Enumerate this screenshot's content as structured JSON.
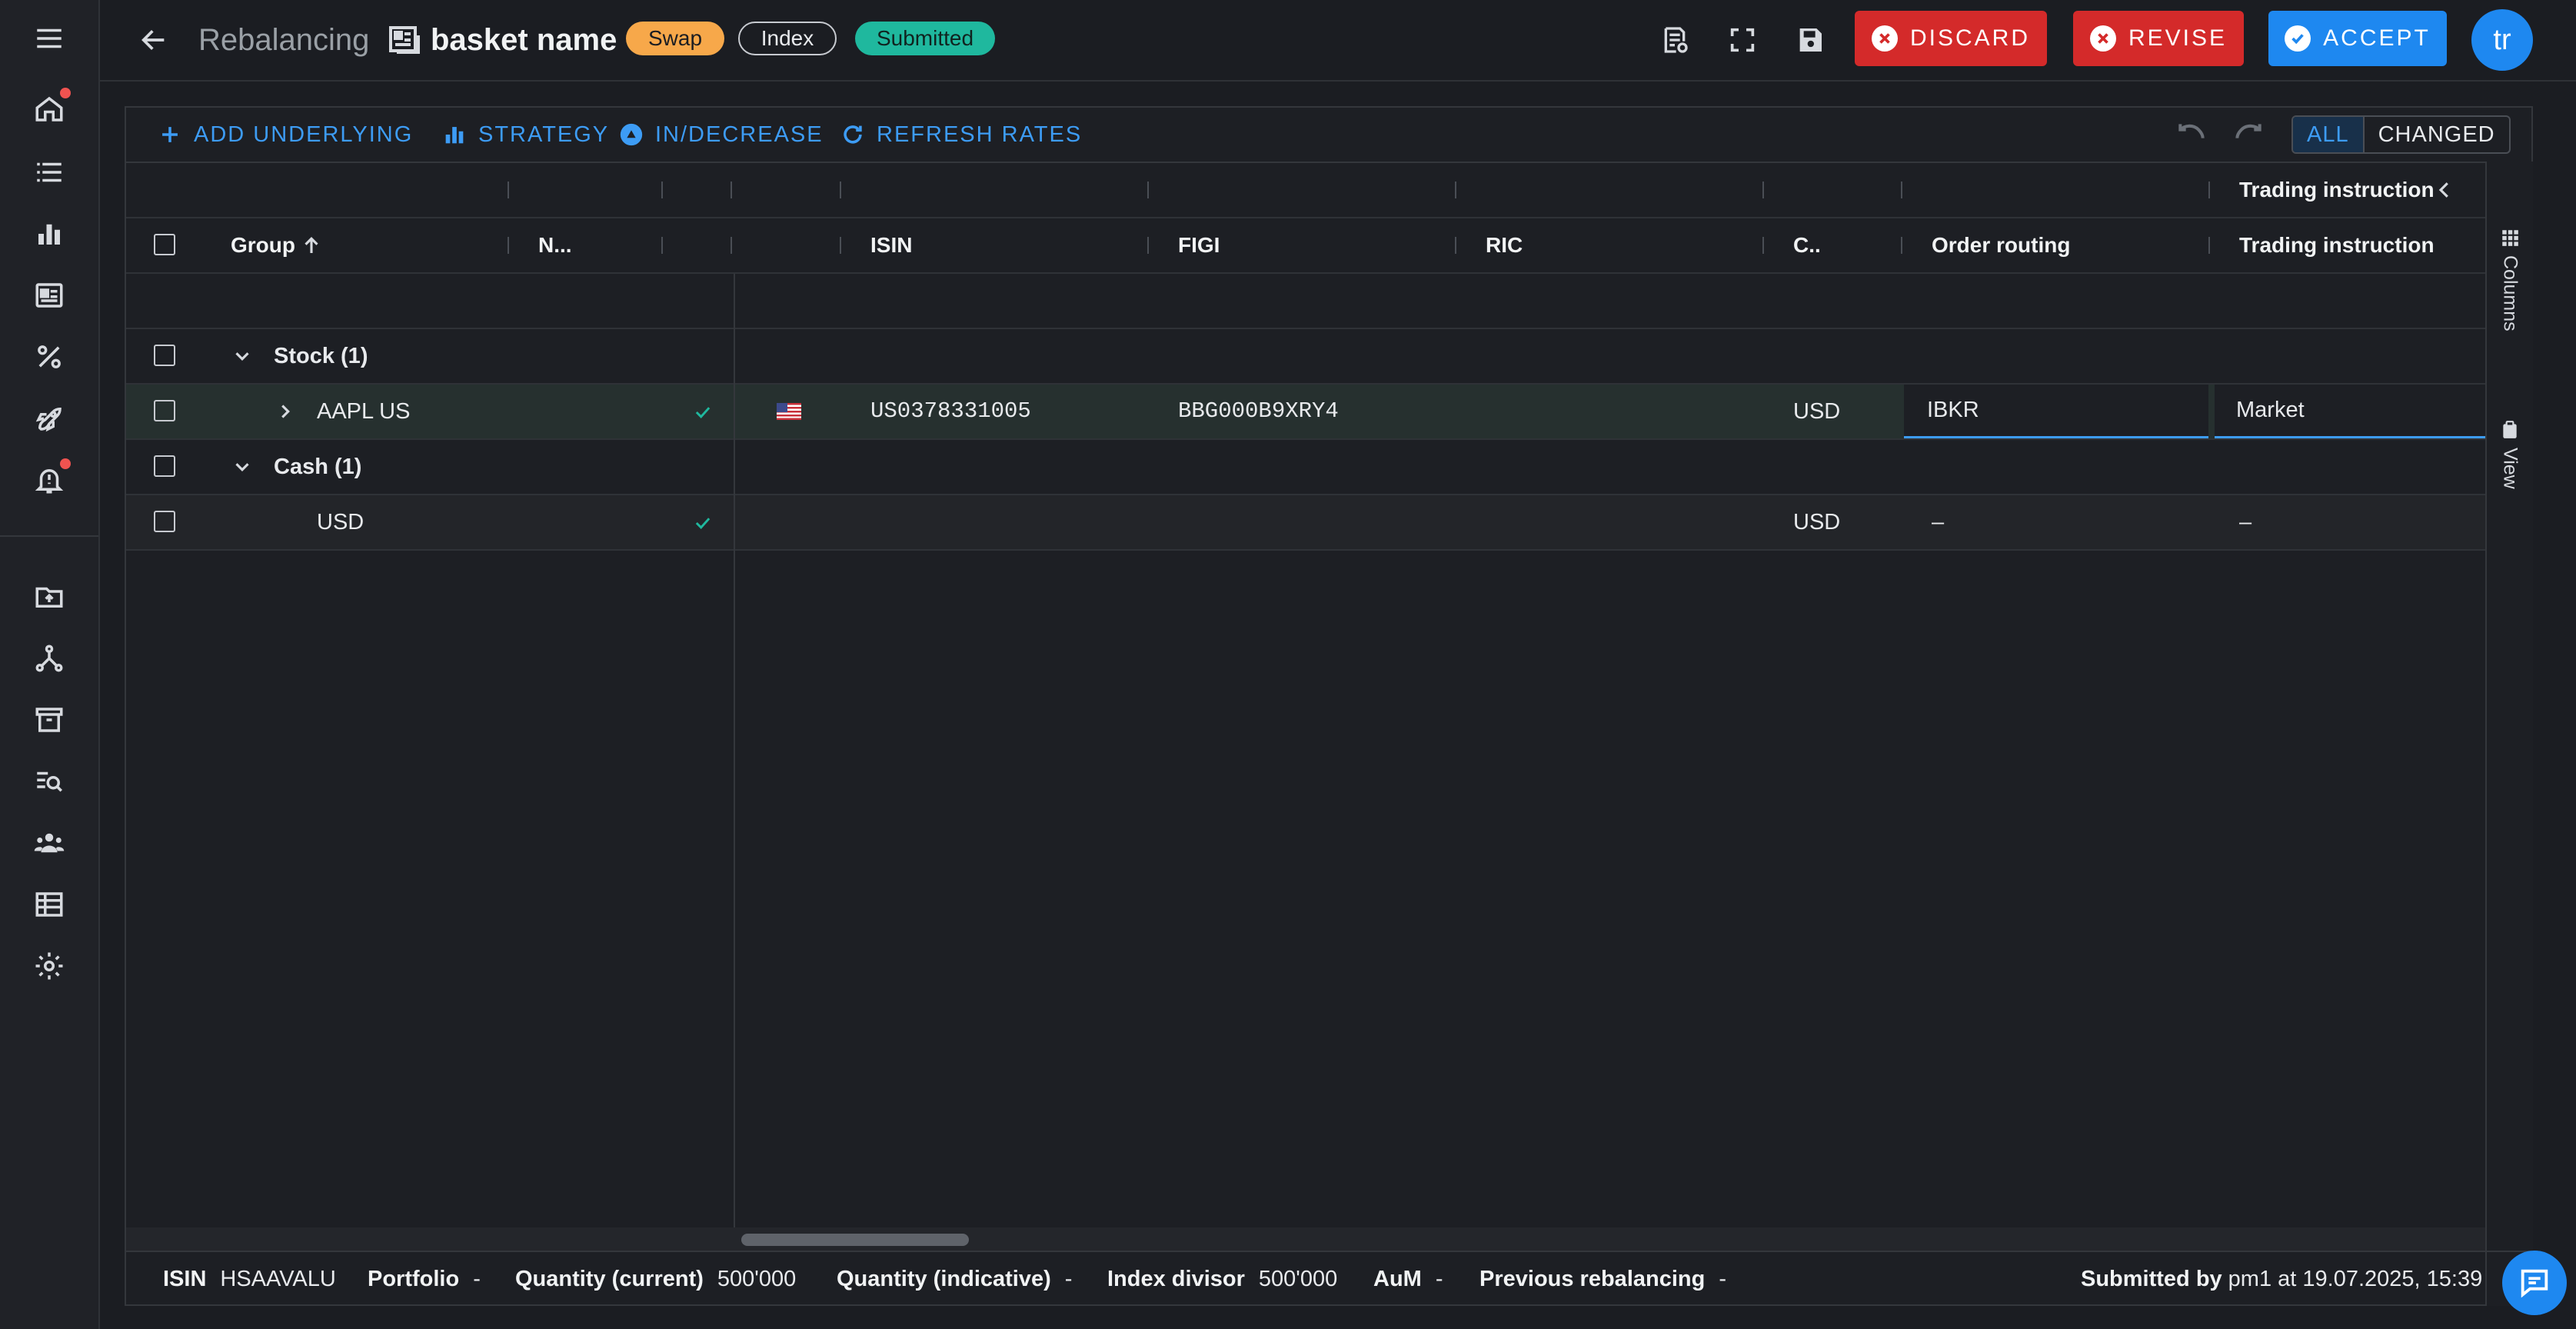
{
  "nav": {
    "items": [
      "menu-icon",
      "home-icon",
      "list-icon",
      "bar-chart-icon",
      "newspaper-icon",
      "percent-icon",
      "rocket-icon",
      "bell-icon",
      "upload-folder-icon",
      "network-icon",
      "archive-icon",
      "search-list-icon",
      "people-icon",
      "table-icon",
      "gear-icon"
    ]
  },
  "header": {
    "parent": "Rebalancing",
    "title": "basket name",
    "pills": {
      "swap": "Swap",
      "index": "Index",
      "status": "Submitted"
    },
    "discard_label": "DISCARD",
    "revise_label": "REVISE",
    "accept_label": "ACCEPT",
    "avatar": "tr"
  },
  "toolbar": {
    "add_underlying": "ADD UNDERLYING",
    "strategy": "STRATEGY",
    "in_decrease": "IN/DECREASE",
    "refresh_rates": "REFRESH RATES",
    "filter_all": "ALL",
    "filter_changed": "CHANGED"
  },
  "grid": {
    "group_header": "Trading instruction",
    "columns": {
      "group": "Group",
      "name": "N...",
      "isin": "ISIN",
      "figi": "FIGI",
      "ric": "RIC",
      "currency": "C..",
      "order_routing": "Order routing",
      "trading_instruction": "Trading instruction"
    },
    "groups": {
      "stock": "Stock (1)",
      "cash": "Cash (1)"
    },
    "rows": [
      {
        "name": "AAPL US",
        "flag": "US",
        "isin": "US0378331005",
        "figi": "BBG000B9XRY4",
        "ric": "",
        "currency": "USD",
        "order_routing": "IBKR",
        "trading_instruction": "Market"
      },
      {
        "name": "USD",
        "isin": "",
        "figi": "",
        "ric": "",
        "currency": "USD",
        "order_routing": "–",
        "trading_instruction": "–"
      }
    ]
  },
  "side_tabs": {
    "columns": "Columns",
    "view": "View"
  },
  "footer": {
    "isin_label": "ISIN",
    "isin": "HSAAVALU",
    "portfolio_label": "Portfolio",
    "portfolio": "-",
    "qty_current_label": "Quantity (current)",
    "qty_current": "500'000",
    "qty_indicative_label": "Quantity (indicative)",
    "qty_indicative": "-",
    "index_divisor_label": "Index divisor",
    "index_divisor": "500'000",
    "aum_label": "AuM",
    "aum": "-",
    "prev_rebal_label": "Previous rebalancing",
    "prev_rebal": "-",
    "submitted_by_label": "Submitted by",
    "submitted_by": "pm1 at 19.07.2025, 15:39"
  },
  "colors": {
    "accent": "#1e88f0",
    "danger": "#d42a2a",
    "success": "#1fb89e",
    "warning": "#f7a84a"
  }
}
